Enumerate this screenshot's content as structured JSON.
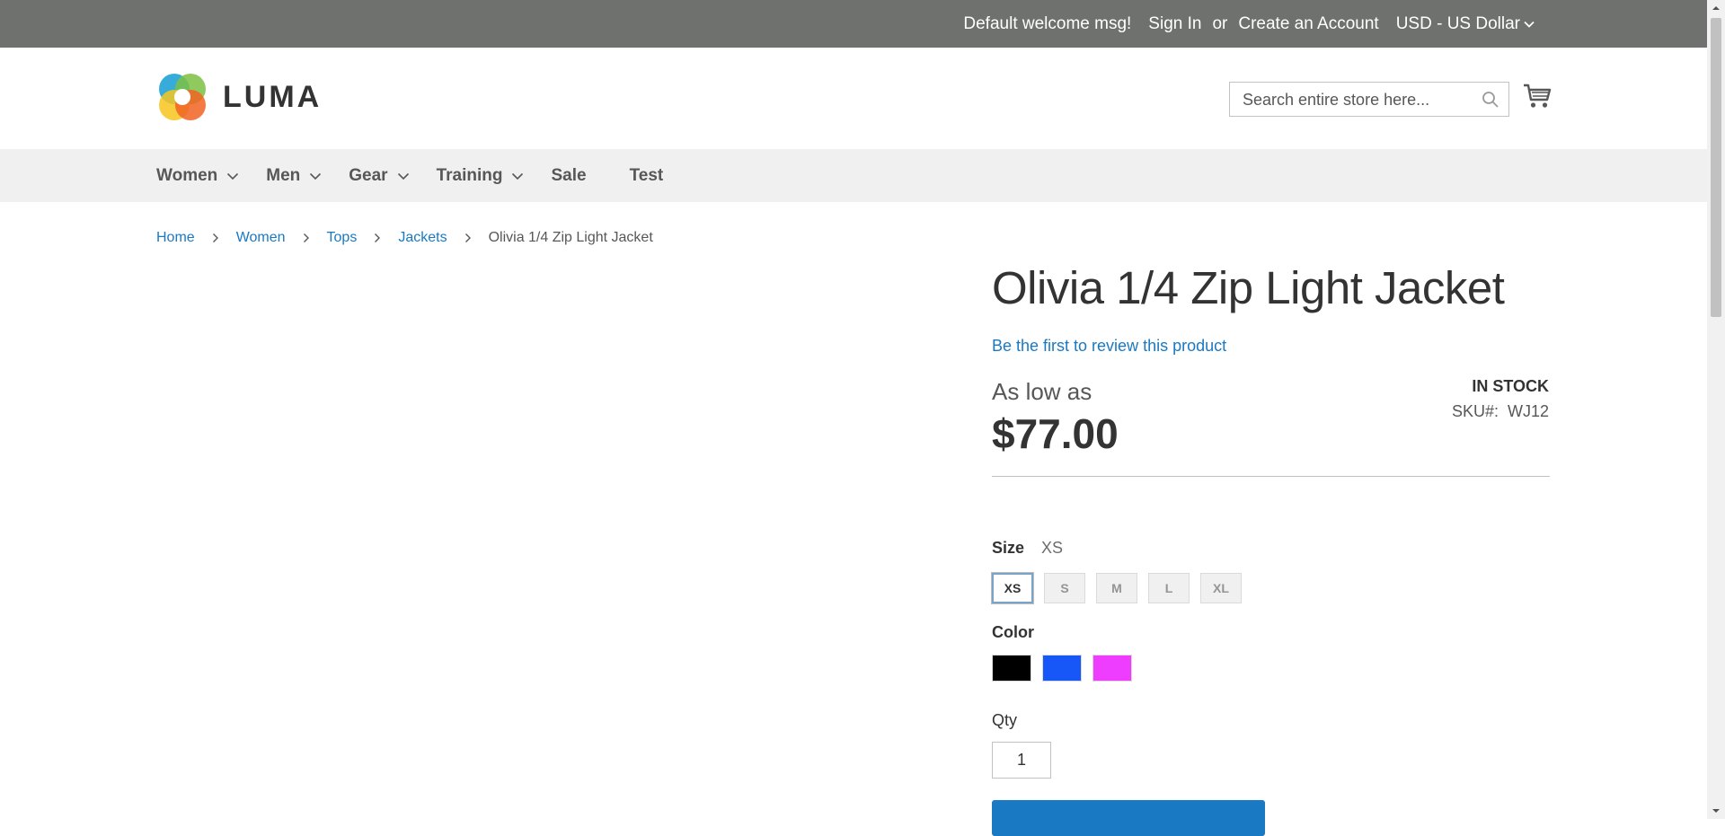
{
  "top_panel": {
    "welcome": "Default welcome msg!",
    "sign_in": "Sign In",
    "or": "or",
    "create_account": "Create an Account",
    "currency": "USD - US Dollar"
  },
  "header": {
    "logo_text": "LUMA",
    "search_placeholder": "Search entire store here...",
    "icons": [
      "search-icon",
      "cart-icon"
    ]
  },
  "nav": {
    "items": [
      {
        "label": "Women",
        "has_dropdown": true
      },
      {
        "label": "Men",
        "has_dropdown": true
      },
      {
        "label": "Gear",
        "has_dropdown": true
      },
      {
        "label": "Training",
        "has_dropdown": true
      },
      {
        "label": "Sale",
        "has_dropdown": false
      },
      {
        "label": "Test",
        "has_dropdown": false
      }
    ]
  },
  "breadcrumb": [
    "Home",
    "Women",
    "Tops",
    "Jackets",
    "Olivia 1/4 Zip Light Jacket"
  ],
  "product": {
    "title": "Olivia 1/4 Zip Light Jacket",
    "review_link": "Be the first to review this product",
    "price_label": "As low as",
    "price": "$77.00",
    "stock": "In stock",
    "sku_label": "SKU#:",
    "sku": "WJ12",
    "size_label": "Size",
    "size_selected": "XS",
    "sizes": [
      "XS",
      "S",
      "M",
      "L",
      "XL"
    ],
    "color_label": "Color",
    "colors": [
      {
        "name": "Black",
        "hex": "#000000"
      },
      {
        "name": "Blue",
        "hex": "#1857f7"
      },
      {
        "name": "Purple",
        "hex": "#ef3dff"
      }
    ],
    "qty_label": "Qty",
    "qty_value": "1"
  },
  "colors": {
    "top_bar": "#6e716e",
    "nav_bg": "#f0f0f0",
    "link": "#1979c3",
    "button": "#1979c3"
  }
}
